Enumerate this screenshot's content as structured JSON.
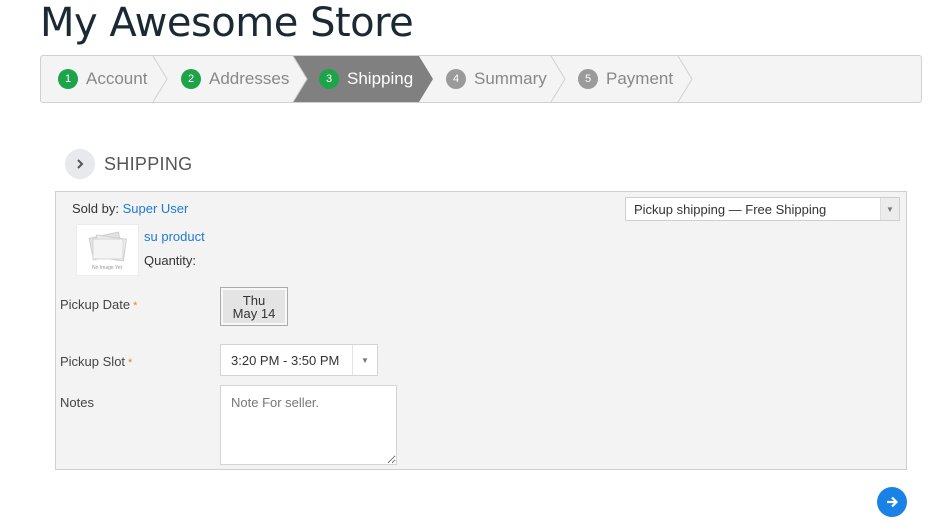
{
  "store": {
    "title": "My Awesome Store"
  },
  "steps": [
    {
      "num": "1",
      "label": "Account",
      "state": "done"
    },
    {
      "num": "2",
      "label": "Addresses",
      "state": "done"
    },
    {
      "num": "3",
      "label": "Shipping",
      "state": "active"
    },
    {
      "num": "4",
      "label": "Summary",
      "state": "todo"
    },
    {
      "num": "5",
      "label": "Payment",
      "state": "todo"
    }
  ],
  "section": {
    "title": "SHIPPING",
    "icon": "chevron-right-icon"
  },
  "seller": {
    "prefix": "Sold by:",
    "name": "Super User"
  },
  "shipping_method": {
    "selected": "Pickup shipping — Free Shipping",
    "icon": "caret-down-icon"
  },
  "product": {
    "name": "su product",
    "quantity_label": "Quantity:",
    "image_text": "No Image Yet"
  },
  "pickup_date": {
    "label": "Pickup Date",
    "required": "*",
    "day": "Thu",
    "date": "May 14"
  },
  "pickup_slot": {
    "label": "Pickup Slot",
    "required": "*",
    "selected": "3:20 PM - 3:50 PM"
  },
  "notes": {
    "label": "Notes",
    "placeholder": "Note For seller."
  },
  "next_button": {
    "icon": "arrow-right-icon"
  },
  "colors": {
    "accent": "#1a82e6",
    "step_done": "#1da44b",
    "step_active_bg": "#808080",
    "link": "#1e7ad1"
  }
}
